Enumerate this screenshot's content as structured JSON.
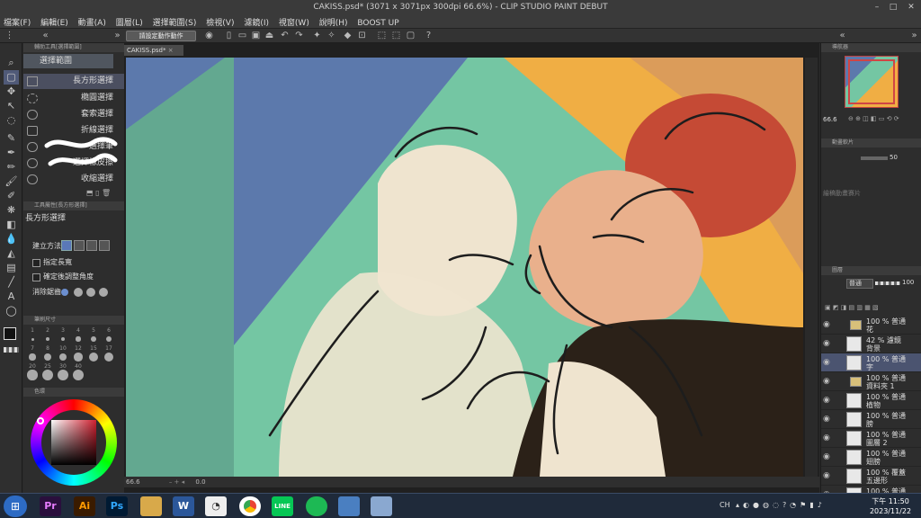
{
  "window": {
    "title": "CAKISS.psd* (3071 x 3071px 300dpi 66.6%) - CLIP STUDIO PAINT DEBUT"
  },
  "menu": [
    "檔案(F)",
    "編輯(E)",
    "動畫(A)",
    "圖層(L)",
    "選擇範圍(S)",
    "檢視(V)",
    "濾鏡(I)",
    "視窗(W)",
    "說明(H)",
    "BOOST UP"
  ],
  "commandbar": {
    "auto_action_label": "請設定動作動作"
  },
  "left": {
    "subtool_header": "輔助工具[選擇範圍]",
    "group_label": "選擇範圍",
    "subtools": [
      "長方形選擇",
      "橢圓選擇",
      "套索選擇",
      "折線選擇",
      "選擇筆",
      "選擇橡皮擦",
      "收縮選擇"
    ],
    "props_header": "工具屬性[長方形選擇]",
    "props_title": "長方形選擇",
    "create_method": "建立方法",
    "fixed_aspect": "指定長寬",
    "adjust_angle": "確定後調整角度",
    "antialias": "消除鋸齒",
    "brush_size_header": "筆刷尺寸",
    "brush_sizes": [
      "1",
      "2",
      "3",
      "4",
      "5",
      "6",
      "7",
      "8",
      "10",
      "12",
      "15",
      "17",
      "20",
      "25",
      "30",
      "40"
    ],
    "color_header": "色環"
  },
  "canvas": {
    "tab": "CAKISS.psd*",
    "zoom": "66.6",
    "angle": "0.0",
    "colors": {
      "blue": "#5c79ac",
      "mint": "#74c6a3",
      "orange": "#f0ae44",
      "red": "#c54a35",
      "skin": "#e9b08c",
      "cream": "#efe4cf",
      "jacket": "#2b2118"
    }
  },
  "right": {
    "navigator_header": "導航器",
    "navigator_zoom": "66.6",
    "anim_header": "動畫軟片",
    "anim_value": "50",
    "anim_placeholder": "繪稿動畫賽片",
    "layer_header": "圖層",
    "blend_mode": "普通",
    "opacity": "100",
    "layers": [
      {
        "l1": "100 % 普通",
        "l2": "花",
        "folder": true
      },
      {
        "l1": "42 % 濾鏡",
        "l2": "背景",
        "folder": false
      },
      {
        "l1": "100 % 普通",
        "l2": "字",
        "folder": false,
        "selected": true
      },
      {
        "l1": "100 % 普通",
        "l2": "資料夾 1",
        "folder": true
      },
      {
        "l1": "100 % 普通",
        "l2": "植物",
        "folder": false
      },
      {
        "l1": "100 % 普通",
        "l2": "膀",
        "folder": false
      },
      {
        "l1": "100 % 普通",
        "l2": "圖層 2",
        "folder": false
      },
      {
        "l1": "100 % 普通",
        "l2": "翅膀",
        "folder": false
      },
      {
        "l1": "100 % 覆蓋",
        "l2": "五邊形",
        "folder": false
      },
      {
        "l1": "100 % 普通",
        "l2": "",
        "folder": false
      }
    ]
  },
  "taskbar": {
    "apps": [
      "Pr",
      "Ai",
      "Ps",
      "",
      "W",
      "",
      "",
      "LINE",
      "",
      "",
      ""
    ],
    "lang": "CH",
    "time": "下午 11:50",
    "date": "2023/11/22"
  }
}
